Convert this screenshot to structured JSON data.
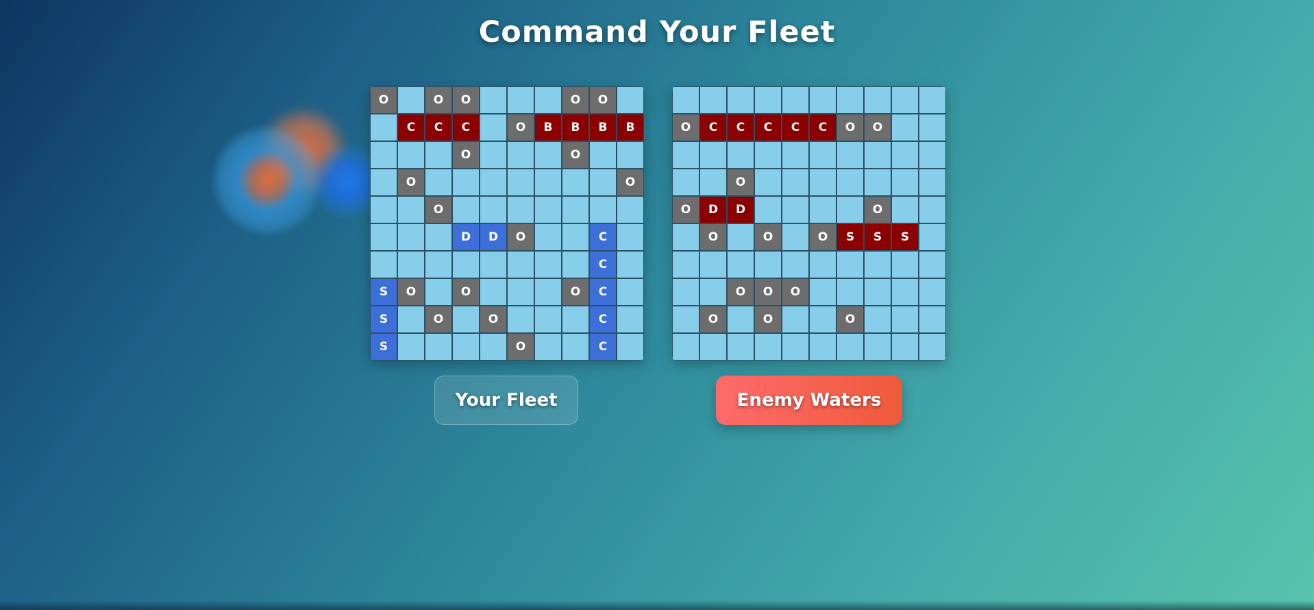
{
  "title": "Command Your Fleet",
  "buttons": {
    "your_fleet": "Your Fleet",
    "enemy_waters": "Enemy Waters"
  },
  "colors": {
    "water": "#87ceeb",
    "miss": "#6d6d6d",
    "hit": "#8b0000",
    "ship": "#3d6fd9",
    "enemy_button_start": "#ff6b6b",
    "enemy_button_end": "#ee5a3a"
  },
  "boards": {
    "your_fleet": [
      [
        "mO",
        "",
        "mO",
        "mO",
        "",
        "",
        "",
        "mO",
        "mO",
        ""
      ],
      [
        "",
        "hC",
        "hC",
        "hC",
        "",
        "mO",
        "hB",
        "hB",
        "hB",
        "hB"
      ],
      [
        "",
        "",
        "",
        "mO",
        "",
        "",
        "",
        "mO",
        "",
        ""
      ],
      [
        "",
        "mO",
        "",
        "",
        "",
        "",
        "",
        "",
        "",
        "mO"
      ],
      [
        "",
        "",
        "mO",
        "",
        "",
        "",
        "",
        "",
        "",
        ""
      ],
      [
        "",
        "",
        "",
        "sD",
        "sD",
        "mO",
        "",
        "",
        "sC",
        ""
      ],
      [
        "",
        "",
        "",
        "",
        "",
        "",
        "",
        "",
        "sC",
        ""
      ],
      [
        "sS",
        "mO",
        "",
        "mO",
        "",
        "",
        "",
        "mO",
        "sC",
        ""
      ],
      [
        "sS",
        "",
        "mO",
        "",
        "mO",
        "",
        "",
        "",
        "sC",
        ""
      ],
      [
        "sS",
        "",
        "",
        "",
        "",
        "mO",
        "",
        "",
        "sC",
        ""
      ]
    ],
    "enemy_waters": [
      [
        "",
        "",
        "",
        "",
        "",
        "",
        "",
        "",
        "",
        ""
      ],
      [
        "mO",
        "hC",
        "hC",
        "hC",
        "hC",
        "hC",
        "mO",
        "mO",
        "",
        ""
      ],
      [
        "",
        "",
        "",
        "",
        "",
        "",
        "",
        "",
        "",
        ""
      ],
      [
        "",
        "",
        "mO",
        "",
        "",
        "",
        "",
        "",
        "",
        ""
      ],
      [
        "mO",
        "hD",
        "hD",
        "",
        "",
        "",
        "",
        "mO",
        "",
        ""
      ],
      [
        "",
        "mO",
        "",
        "mO",
        "",
        "mO",
        "hS",
        "hS",
        "hS",
        ""
      ],
      [
        "",
        "",
        "",
        "",
        "",
        "",
        "",
        "",
        "",
        ""
      ],
      [
        "",
        "",
        "mO",
        "mO",
        "mO",
        "",
        "",
        "",
        "",
        ""
      ],
      [
        "",
        "mO",
        "",
        "mO",
        "",
        "",
        "mO",
        "",
        "",
        ""
      ],
      [
        "",
        "",
        "",
        "",
        "",
        "",
        "",
        "",
        "",
        ""
      ]
    ]
  }
}
